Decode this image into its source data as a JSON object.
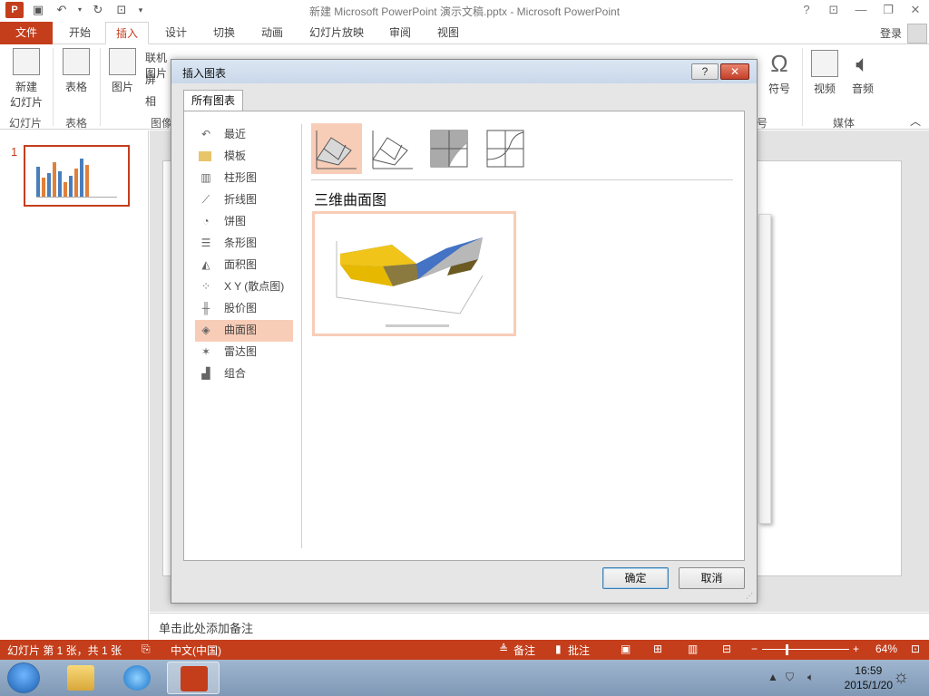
{
  "window": {
    "title": "新建 Microsoft PowerPoint 演示文稿.pptx - Microsoft PowerPoint",
    "help": "?",
    "controls": [
      "?",
      "□",
      "—",
      "□",
      "✕"
    ]
  },
  "qat": {
    "logo": "P",
    "save_icon": "save-icon",
    "undo_icon": "undo-icon",
    "redo_icon": "redo-icon"
  },
  "ribbon_tabs": [
    "文件",
    "开始",
    "插入",
    "设计",
    "切换",
    "动画",
    "幻灯片放映",
    "审阅",
    "视图"
  ],
  "active_tab": "插入",
  "account": {
    "login": "登录"
  },
  "ribbon": {
    "new_slide": "新建\n幻灯片",
    "new_slide_line1": "新建",
    "new_slide_line2": "幻灯片",
    "table": "表格",
    "picture": "图片",
    "symbol": "符号",
    "video": "视频",
    "audio": "音频",
    "group_slides": "幻灯片",
    "group_tables": "表格",
    "group_images": "图像",
    "group_symbols": "号",
    "group_media": "媒体",
    "partial_1": "联机图片",
    "partial_2": "屏",
    "partial_3": "相"
  },
  "thumbnails": {
    "slide_number": "1"
  },
  "notes": {
    "placeholder": "单击此处添加备注"
  },
  "status": {
    "slide_info": "幻灯片 第 1 张，共 1 张",
    "language": "中文(中国)",
    "notes": "备注",
    "comments": "批注",
    "zoom": "64%",
    "minus": "−",
    "plus": "+"
  },
  "taskbar": {
    "time": "16:59",
    "date": "2015/1/20"
  },
  "dialog": {
    "title": "插入图表",
    "help_button": "?",
    "close_button": "✕",
    "tab": "所有图表",
    "categories": [
      {
        "label": "最近",
        "icon": "recent-icon"
      },
      {
        "label": "模板",
        "icon": "folder-icon"
      },
      {
        "label": "柱形图",
        "icon": "column-chart-icon"
      },
      {
        "label": "折线图",
        "icon": "line-chart-icon"
      },
      {
        "label": "饼图",
        "icon": "pie-chart-icon"
      },
      {
        "label": "条形图",
        "icon": "bar-chart-icon"
      },
      {
        "label": "面积图",
        "icon": "area-chart-icon"
      },
      {
        "label": "X Y (散点图)",
        "icon": "scatter-chart-icon"
      },
      {
        "label": "股价图",
        "icon": "stock-chart-icon"
      },
      {
        "label": "曲面图",
        "icon": "surface-chart-icon"
      },
      {
        "label": "雷达图",
        "icon": "radar-chart-icon"
      },
      {
        "label": "组合",
        "icon": "combo-chart-icon"
      }
    ],
    "selected_category": "曲面图",
    "subtypes": [
      "三维曲面图",
      "三维线框曲面图",
      "曲面图",
      "线框曲面图"
    ],
    "selected_subtype_title": "三维曲面图",
    "ok_button": "确定",
    "cancel_button": "取消"
  },
  "colors": {
    "accent": "#c43e1c",
    "selection": "#f8cdb8",
    "statusbar": "#c43e1c"
  }
}
